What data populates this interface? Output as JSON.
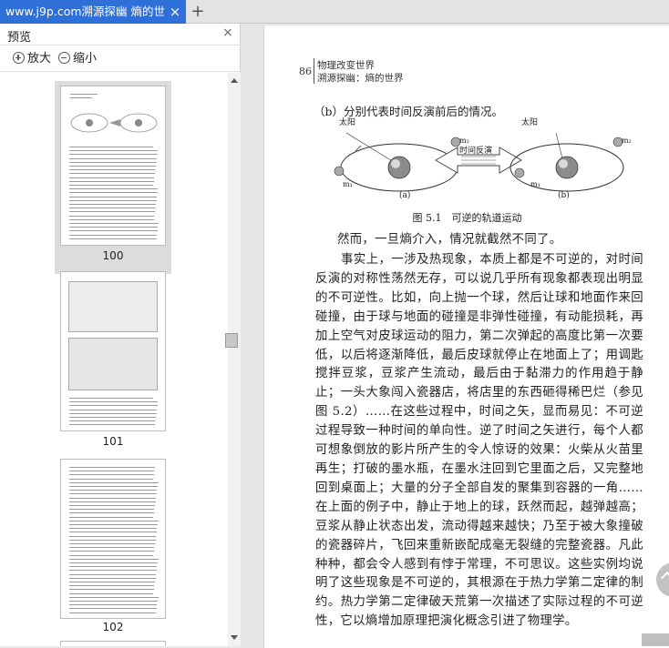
{
  "tab": {
    "title": "www.j9p.com溯源探幽 熵的世",
    "close": "×",
    "add": "+"
  },
  "sidebar": {
    "title": "预览",
    "close": "×",
    "zoom_in": "放大",
    "zoom_out": "缩小",
    "thumbnails": [
      {
        "page": "100",
        "selected": true
      },
      {
        "page": "101",
        "selected": false
      },
      {
        "page": "102",
        "selected": false
      }
    ]
  },
  "document": {
    "page_number": "86",
    "header_line1": "物理改变世界",
    "header_line2": "溯源探幽：熵的世界",
    "caption_b": "（b）分别代表时间反演前后的情况。",
    "figure": {
      "sun_label_left": "太阳",
      "sun_label_right": "太阳",
      "arrow_label": "时间反演",
      "m1": "m₁",
      "m2": "m₂",
      "label_a": "(a)",
      "label_b": "(b)",
      "title": "图 5.1　可逆的轨道运动"
    },
    "para1": "然而，一旦熵介入，情况就截然不同了。",
    "para2": "事实上，一涉及热现象，本质上都是不可逆的，对时间反演的对称性荡然无存，可以说几乎所有现象都表现出明显的不可逆性。比如，向上抛一个球，然后让球和地面作来回碰撞，由于球与地面的碰撞是非弹性碰撞，有动能损耗，再加上空气对皮球运动的阻力，第二次弹起的高度比第一次要低，以后将逐渐降低，最后皮球就停止在地面上了；用调匙搅拌豆浆，豆浆产生流动，最后由于黏滞力的作用趋于静止；一头大象闯入瓷器店，将店里的东西砸得稀巴烂（参见图 5.2）……在这些过程中，时间之矢，显而易见：不可逆过程导致一种时间的单向性。逆了时间之矢进行，每个人都可想象倒放的影片所产生的令人惊讶的效果：火柴从火苗里再生；打破的墨水瓶，在墨水注回到它里面之后，又完整地回到桌面上；大量的分子全部自发的聚集到容器的一角……在上面的例子中，静止于地上的球，跃然而起，越弹越高；豆浆从静止状态出发，流动得越来越快；乃至于被大象撞破的瓷器碎片，飞回来重新嵌配成毫无裂缝的完整瓷器。凡此种种，都会令人感到有悖于常理，不可思议。这些实例均说明了这些现象是不可逆的，其根源在于热力学第二定律的制约。热力学第二定律破天荒第一次描述了实际过程的不可逆性，它以熵增加原理把演化概念引进了物理学。"
  },
  "colors": {
    "tab_active": "#2f6fd8",
    "panel_bg": "#ffffff",
    "viewer_bg": "#e6e6e6"
  }
}
